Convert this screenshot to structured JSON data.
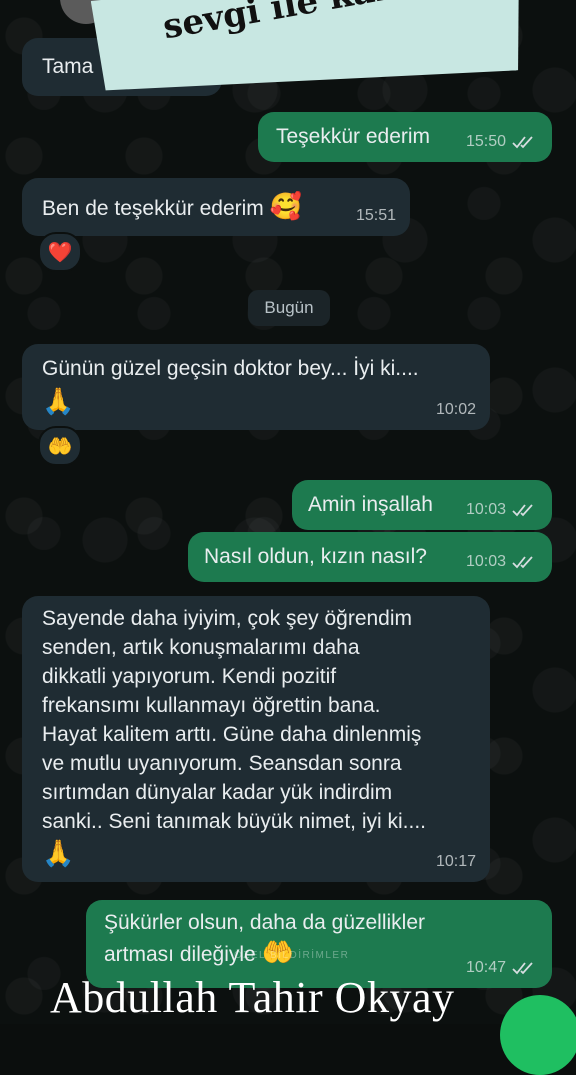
{
  "banner_text": "sevgi ile kalın",
  "date_divider": "Bugün",
  "messages": [
    {
      "direction": "in",
      "text": "Tama",
      "time": ""
    },
    {
      "direction": "out",
      "text": "Teşekkür ederim",
      "time": "15:50"
    },
    {
      "direction": "in",
      "text": "Ben de teşekkür ederim",
      "emoji": "🥰",
      "time": "15:51",
      "reaction": "❤️"
    },
    {
      "direction": "in",
      "lines": [
        "Günün güzel geçsin doktor bey... İyi ki...."
      ],
      "emoji": "🙏",
      "time": "10:02",
      "reaction": "🤲"
    },
    {
      "direction": "out",
      "text": "Amin inşallah",
      "time": "10:03"
    },
    {
      "direction": "out",
      "text": "Nasıl oldun, kızın nasıl?",
      "time": "10:03"
    },
    {
      "direction": "in",
      "lines": [
        "Sayende daha iyiyim, çok şey öğrendim",
        "senden, artık konuşmalarımı daha",
        "dikkatli yapıyorum. Kendi pozitif",
        "frekansımı kullanmayı öğrettin bana.",
        "Hayat kalitem arttı. Güne daha dinlenmiş",
        "ve mutlu uyanıyorum. Seansdan sonra",
        "sırtımdan dünyalar kadar yük indirdim",
        "sanki.. Seni tanımak büyük nimet, iyi ki...."
      ],
      "emoji": "🙏",
      "time": "10:17"
    },
    {
      "direction": "out",
      "lines": [
        "Şükürler olsun, daha da güzellikler",
        "artması dileğiyle"
      ],
      "emoji": "🤲",
      "time": "10:47"
    }
  ],
  "watermark": "ÖZEL BİLDİRİMLER",
  "signature": "Abdullah Tahir Okyay",
  "colors": {
    "incoming": "#1f2c33",
    "outgoing": "#1d7a4f",
    "background": "#0c100f",
    "banner": "#c8e7e2"
  }
}
